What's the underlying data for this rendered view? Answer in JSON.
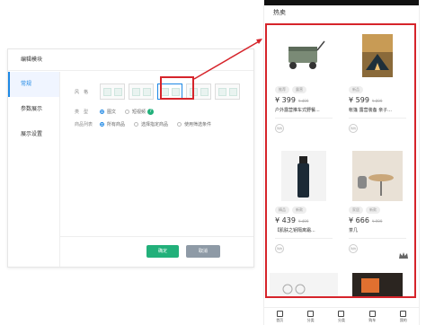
{
  "editor": {
    "title": "编辑模块",
    "sidebar": [
      "常规",
      "参数展示",
      "展示设置"
    ],
    "style_label": "风　格",
    "type_label": "类　型",
    "type_options": [
      "图文",
      "短视频"
    ],
    "help_glyph": "?",
    "products_label": "商品列表",
    "product_options": [
      "所有商品",
      "选择指定商品",
      "使用筛选条件"
    ],
    "ok_label": "确定",
    "cancel_label": "取消"
  },
  "phone": {
    "title": "热卖",
    "cards": [
      {
        "tags": [
          "推荐",
          "露营"
        ],
        "price": "¥ 399",
        "old_price": "¥ 499",
        "name": "户外露营推车式野餐...",
        "cart": "购物"
      },
      {
        "tags": [
          "新品"
        ],
        "price": "¥ 599",
        "old_price": "¥ 899",
        "name": "帐篷 露营装备 亲子...",
        "cart": "购物"
      },
      {
        "tags": [
          "精品",
          "新款"
        ],
        "price": "¥ 439",
        "old_price": "¥ 499",
        "name": "【肌肤之钥隔离霜...",
        "cart": "购物"
      },
      {
        "tags": [
          "家居",
          "新款"
        ],
        "price": "¥ 666",
        "old_price": "¥ 999",
        "name": "茶几",
        "cart": "购物"
      }
    ],
    "tabs": [
      "首页",
      "分类",
      "分类",
      "购车",
      "我的"
    ]
  }
}
